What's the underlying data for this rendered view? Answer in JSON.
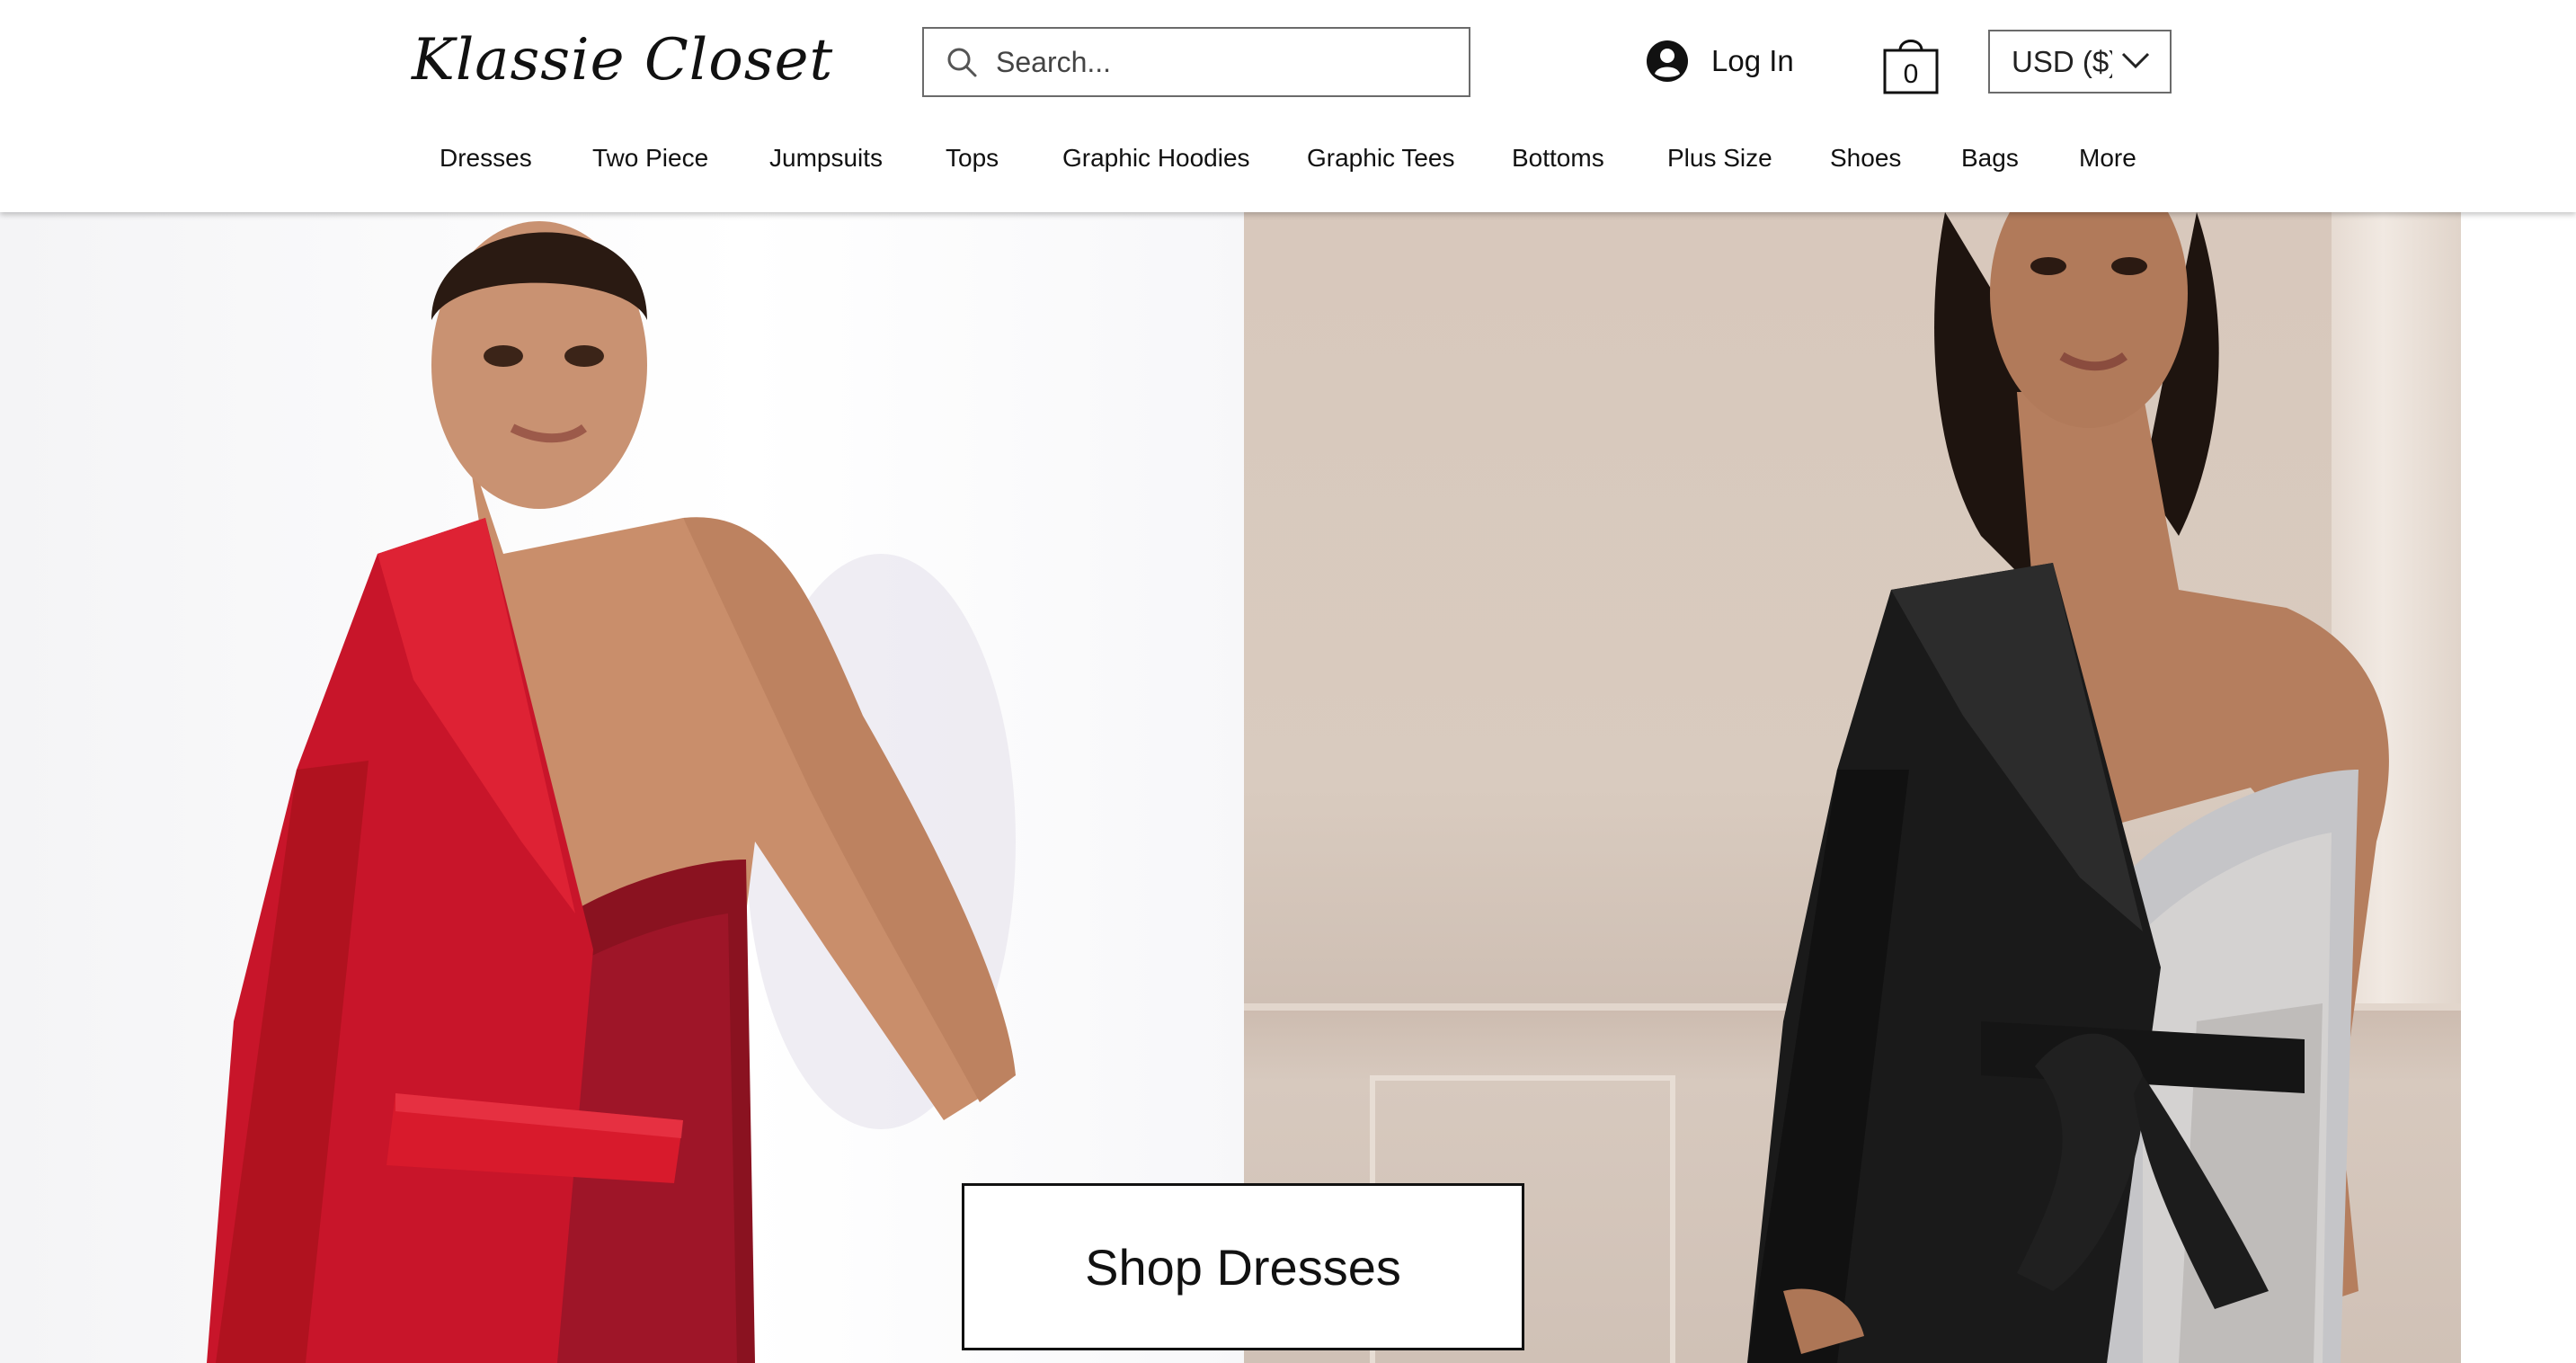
{
  "header": {
    "logo_text": "Klassie Closet",
    "search": {
      "placeholder": "Search...",
      "icon": "search-icon"
    },
    "login_label": "Log In",
    "login_icon": "user-avatar-icon",
    "cart": {
      "icon": "shopping-bag-icon",
      "count": "0"
    },
    "currency": {
      "selected": "USD ($)",
      "icon": "chevron-down-icon"
    }
  },
  "nav": {
    "items": [
      {
        "label": "Dresses"
      },
      {
        "label": "Two Piece"
      },
      {
        "label": "Jumpsuits"
      },
      {
        "label": "Tops"
      },
      {
        "label": "Graphic Hoodies"
      },
      {
        "label": "Graphic Tees"
      },
      {
        "label": "Bottoms"
      },
      {
        "label": "Plus Size"
      },
      {
        "label": "Shoes"
      },
      {
        "label": "Bags"
      },
      {
        "label": "More"
      }
    ]
  },
  "hero": {
    "cta_label": "Shop Dresses",
    "left_image": {
      "subject": "model in red tuxedo dress with sequins"
    },
    "right_image": {
      "subject": "model in black tuxedo dress with silver sequins"
    }
  },
  "colors": {
    "header_bg": "#ffffff",
    "text": "#111111",
    "border": "#6b6b6b",
    "red_dress": "#c8152a",
    "black_dress": "#1a1a1a",
    "sequin_silver": "#c9c9cc"
  }
}
